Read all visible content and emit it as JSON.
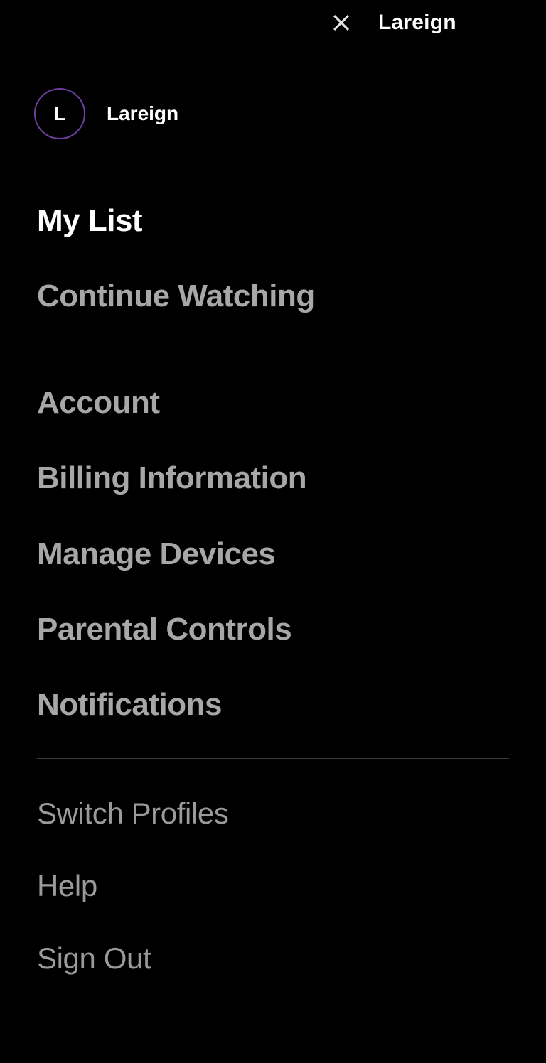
{
  "header": {
    "name": "Lareign"
  },
  "profile": {
    "initial": "L",
    "name": "Lareign"
  },
  "menu": {
    "primary": [
      {
        "label": "My List",
        "active": true
      },
      {
        "label": "Continue Watching",
        "active": false
      }
    ],
    "account": [
      {
        "label": "Account"
      },
      {
        "label": "Billing Information"
      },
      {
        "label": "Manage Devices"
      },
      {
        "label": "Parental Controls"
      },
      {
        "label": "Notifications"
      }
    ],
    "secondary": [
      {
        "label": "Switch Profiles"
      },
      {
        "label": "Help"
      },
      {
        "label": "Sign Out"
      }
    ]
  },
  "colors": {
    "background": "#000000",
    "avatar_border": "#6b3fa0",
    "text_primary": "#ffffff",
    "text_muted": "#a7a7a7",
    "divider": "#3a3a3a"
  }
}
